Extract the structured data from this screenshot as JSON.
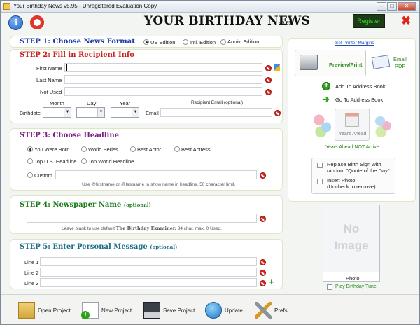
{
  "window": {
    "title": "Your Birthday News v5.95 - Unregistered Evaluation Copy",
    "min": "–",
    "max": "□",
    "close": "✕"
  },
  "header": {
    "brand": "YOUR BIRTHDAY NEWS",
    "version": "v5.95",
    "register": "Register",
    "close_glyph": "✖"
  },
  "step1": {
    "title": "STEP 1: Choose News Format",
    "options": [
      "US Edition",
      "Intl. Edition",
      "Anniv. Edition"
    ]
  },
  "step2": {
    "title": "STEP 2: Fill in Recipient Info",
    "first_name": "First Name",
    "last_name": "Last Name",
    "not_used": "Not Used",
    "month": "Month",
    "day": "Day",
    "year": "Year",
    "birthdate": "Birthdate",
    "email": "Email",
    "recipient_email": "Recipient Email (optional)"
  },
  "step3": {
    "title": "STEP 3: Choose Headline",
    "options": [
      "You Were Born",
      "World Series",
      "Best Actor",
      "Best Actress",
      "Top U.S. Headline",
      "Top World Headline",
      "Custom"
    ],
    "hint": "Use @firstname or @lastname to show name in headline. 50 character limit."
  },
  "step4": {
    "title": "STEP 4: Newspaper Name",
    "optional": "(optional)",
    "hint_prefix": "Leave blank to use default",
    "hint_name": "The Birthday Examiner.",
    "hint_suffix": "34 char. max. 0 Used."
  },
  "step5": {
    "title": "STEP 5: Enter Personal Message",
    "optional": "(optional)",
    "lines": [
      "Line 1",
      "Line 2",
      "Line 3"
    ]
  },
  "side": {
    "printer_margins": "Set Printer Margins",
    "preview_print": "Preview/Print",
    "email_pdf_1": "Email",
    "email_pdf_2": "PDF",
    "add_address": "Add To Address Book",
    "goto_address": "Go To Address Book",
    "years_ahead": "Years Ahead",
    "years_ahead_status": "Years Ahead NOT Active",
    "replace_sign_1": "Replace Birth Sign with",
    "replace_sign_2": "random \"Quote of the Day\"",
    "insert_photo_1": "Insert Photo",
    "insert_photo_2": "(Uncheck to remove)"
  },
  "photo": {
    "placeholder_1": "No",
    "placeholder_2": "Image",
    "label": "Photo",
    "play_tune": "Play Birthday Tune"
  },
  "toolbar": {
    "open": "Open Project",
    "new": "New Project",
    "save": "Save Project",
    "update": "Update",
    "prefs": "Prefs"
  },
  "colors": {
    "step1": "#1f3fa8",
    "step2": "#c8201a",
    "step3": "#7a1d86",
    "step4": "#1a7a1a",
    "step5": "#1a6f86",
    "accent_green": "#2a8a1a"
  }
}
